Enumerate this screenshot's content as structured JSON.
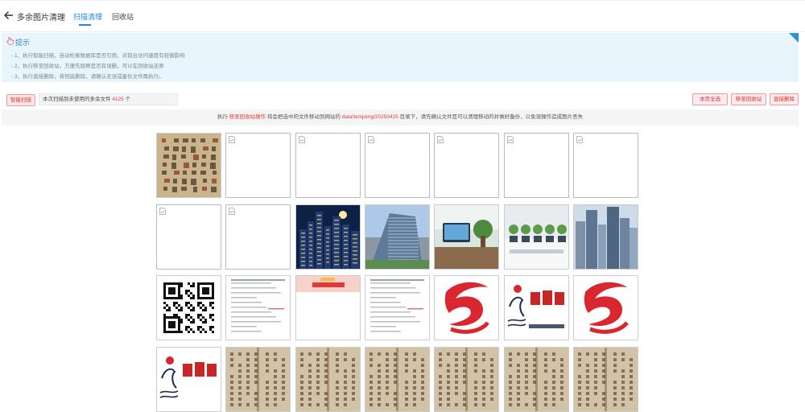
{
  "header": {
    "back_icon": "arrow-left-icon",
    "title": "多余图片清理",
    "tabs": [
      {
        "label": "扫描清理",
        "active": true
      },
      {
        "label": "回收站",
        "active": false
      }
    ]
  },
  "tips": {
    "icon": "hand-pointer-icon",
    "title": "提示",
    "lines": [
      "- 1、执行智能扫描，自动检索数据库是否引用，对前台访问速度有轻微影响",
      "- 2、执行移至回收站，方便先观察是否有误删，可以在回收站还原",
      "- 3、执行直接删除，将彻底删除，请确认无误或备份文件再执行。"
    ]
  },
  "toolbar": {
    "smart_scan": "智能扫描",
    "count_prefix": "本次扫描到未使用的多余文件",
    "count_value": "4125",
    "count_suffix": "个",
    "select_all": "本页全选",
    "move_to_recycle": "移至回收站",
    "direct_delete": "直接删除"
  },
  "notice": {
    "part1": "执行",
    "action": "移至回收站操作",
    "part2": "将会把选中的文件移动到网站的",
    "path": "data/tempimg/20250425",
    "part3": "目录下，请先确认文件是可以清理移动的并做好备份，以免误操作造成图片丢失"
  },
  "images": [
    {
      "kind": "calligraphy"
    },
    {
      "kind": "broken"
    },
    {
      "kind": "broken"
    },
    {
      "kind": "broken"
    },
    {
      "kind": "broken"
    },
    {
      "kind": "broken"
    },
    {
      "kind": "broken"
    },
    {
      "kind": "broken"
    },
    {
      "kind": "broken"
    },
    {
      "kind": "city-night"
    },
    {
      "kind": "office-tower"
    },
    {
      "kind": "office-desk"
    },
    {
      "kind": "office-plants"
    },
    {
      "kind": "skyscrapers"
    },
    {
      "kind": "qr-code"
    },
    {
      "kind": "document"
    },
    {
      "kind": "banner"
    },
    {
      "kind": "document"
    },
    {
      "kind": "red-logo"
    },
    {
      "kind": "guji-logo"
    },
    {
      "kind": "red-logo"
    },
    {
      "kind": "guji-logo"
    },
    {
      "kind": "old-book"
    },
    {
      "kind": "old-book"
    },
    {
      "kind": "old-book"
    },
    {
      "kind": "old-book"
    },
    {
      "kind": "old-book"
    },
    {
      "kind": "old-book"
    }
  ]
}
